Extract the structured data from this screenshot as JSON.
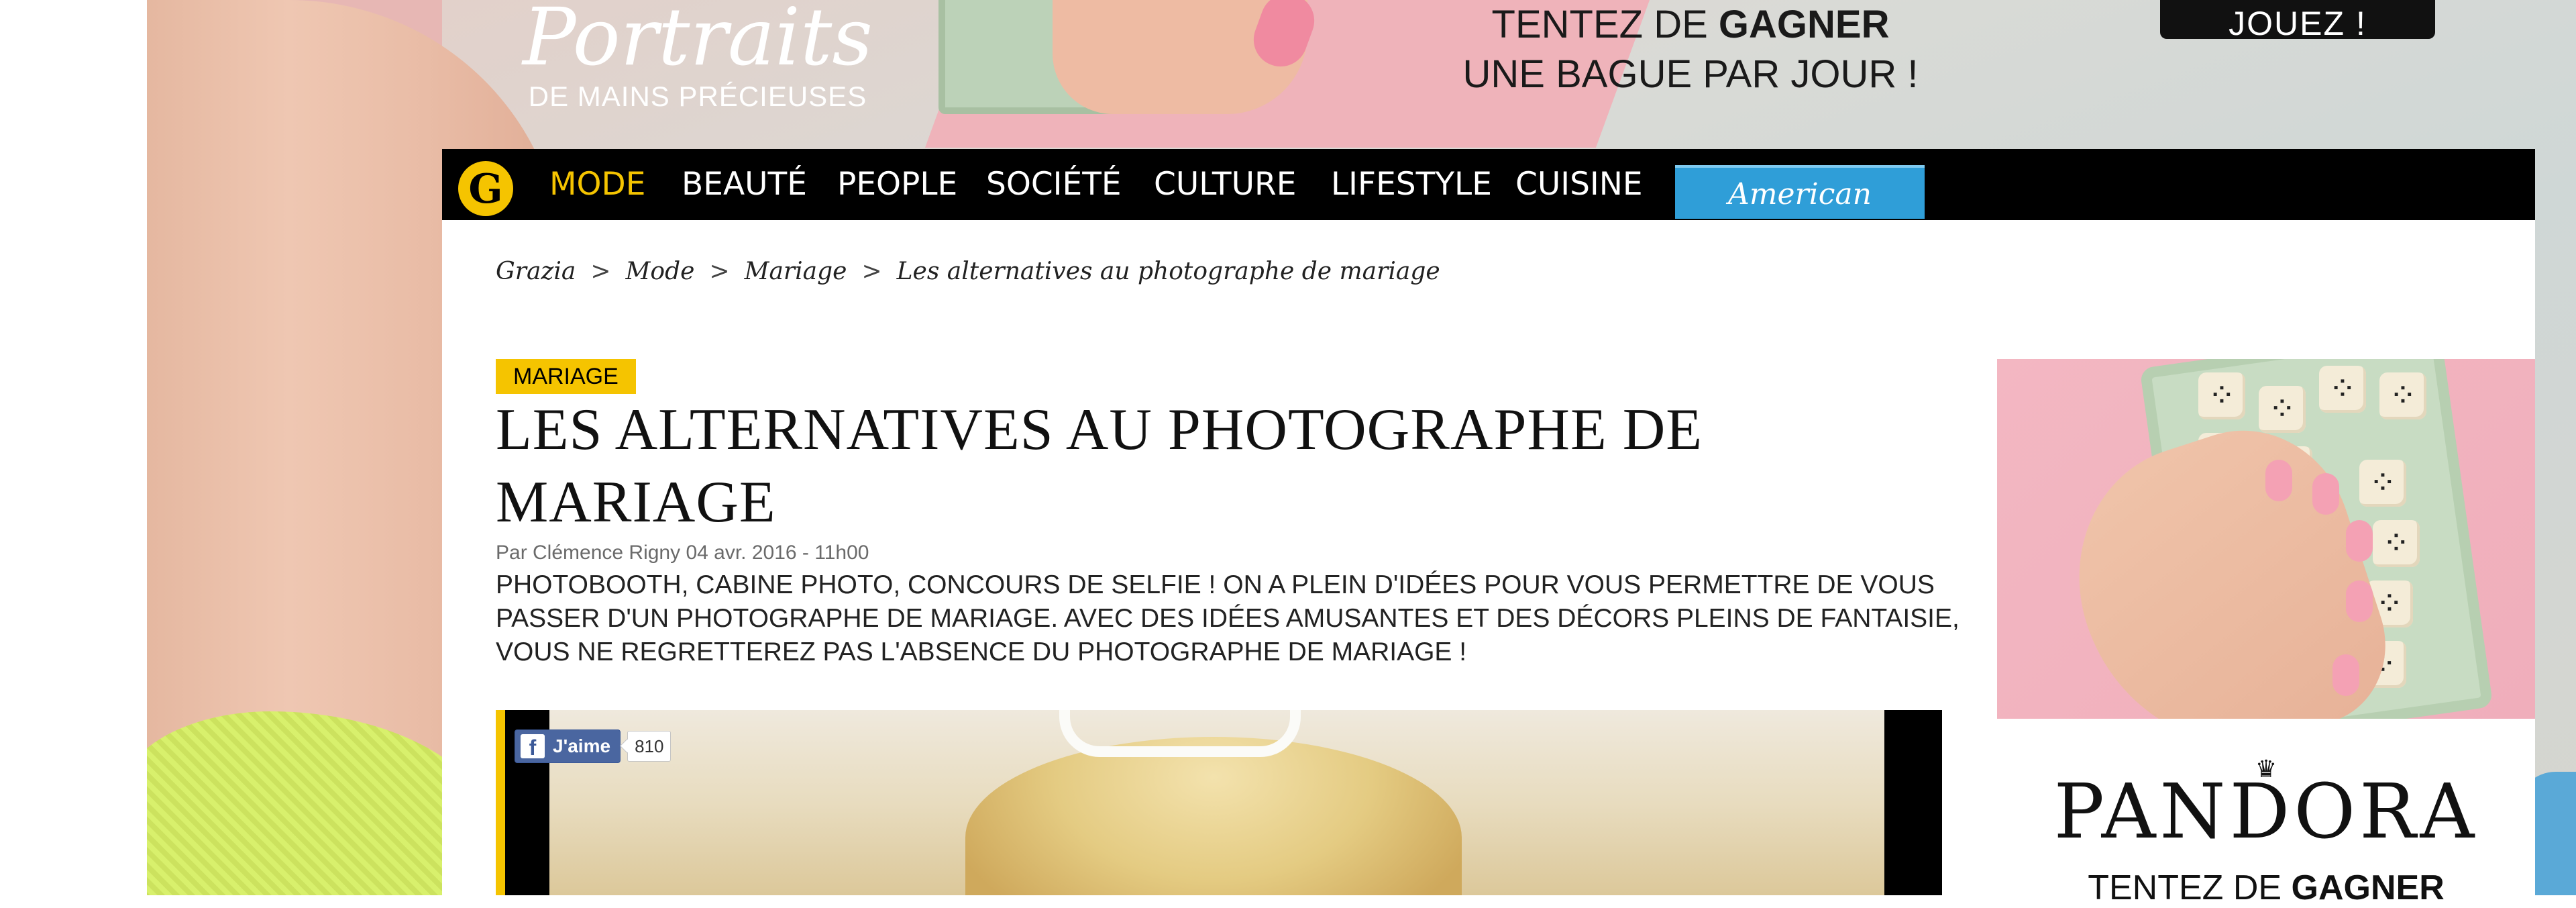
{
  "top_ad": {
    "logo_script": "Portraits",
    "logo_sub": "DE MAINS PRÉCIEUSES",
    "promo_line1_prefix": "TENTEZ DE",
    "promo_line1_bold": "GAGNER",
    "promo_line2": "UNE BAGUE PAR JOUR !",
    "cta": "JOUEZ !"
  },
  "nav": {
    "logo_letter": "G",
    "items": [
      {
        "label": "MODE",
        "active": true
      },
      {
        "label": "BEAUTÉ"
      },
      {
        "label": "PEOPLE"
      },
      {
        "label": "SOCIÉTÉ"
      },
      {
        "label": "CULTURE"
      },
      {
        "label": "LIFESTYLE"
      },
      {
        "label": "CUISINE"
      }
    ],
    "brand_banner": "American Vintage"
  },
  "breadcrumb": {
    "items": [
      "Grazia",
      "Mode",
      "Mariage",
      "Les alternatives au photographe de mariage"
    ],
    "separator": ">"
  },
  "article": {
    "tag": "MARIAGE",
    "title": "LES ALTERNATIVES AU PHOTOGRAPHE DE MARIAGE",
    "byline": "Par Clémence Rigny 04 avr. 2016 - 11h00",
    "lede": "PHOTOBOOTH, CABINE PHOTO, CONCOURS DE SELFIE ! ON A PLEIN D'IDÉES POUR VOUS PERMETTRE DE VOUS PASSER D'UN PHOTOGRAPHE DE MARIAGE. AVEC DES IDÉES AMUSANTES ET DES DÉCORS PLEINS DE FANTAISIE, VOUS NE REGRETTEREZ PAS L'ABSENCE DU PHOTOGRAPHE DE MARIAGE !"
  },
  "facebook": {
    "icon_letter": "f",
    "like_label": "J'aime",
    "count": "810"
  },
  "side_ad": {
    "brand": "PANDORA",
    "crown_glyph": "♛",
    "promo_prefix": "TENTEZ DE",
    "promo_bold": "GAGNER"
  },
  "colors": {
    "accent_yellow": "#f5c400",
    "nav_bg": "#000000",
    "facebook_blue": "#4a66a0",
    "brand_banner_blue": "#2f9ed8"
  }
}
